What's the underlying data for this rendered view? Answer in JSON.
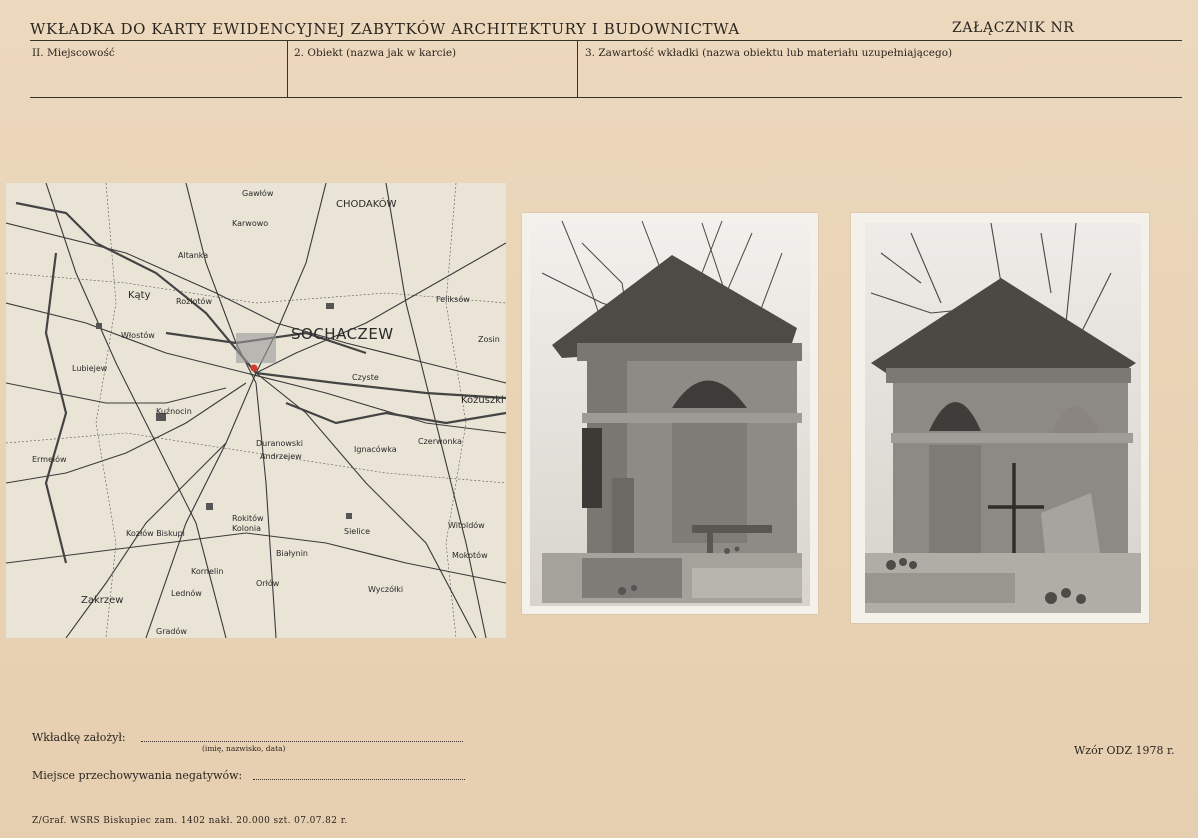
{
  "header": {
    "title": "WKŁADKA DO KARTY EWIDENCYJNEJ ZABYTKÓW ARCHITEKTURY I BUDOWNICTWA",
    "annex": "ZAŁĄCZNIK NR"
  },
  "fields": {
    "locality": "II. Miejscowość",
    "object": "2. Obiekt (nazwa jak w karcie)",
    "contents": "3. Zawartość wkładki (nazwa obiektu lub materiału uzupełniającego)"
  },
  "map": {
    "labels": {
      "sochaczew": "SOCHACZEW",
      "chodakow": "CHODAKÓW",
      "katy": "Kąty",
      "razlotow": "Rozlotów",
      "felikslow": "Feliksów",
      "gawlow": "Gawłów",
      "karwowo": "Karwowo",
      "altanka": "Altanka",
      "kozuszki": "Kożuszki",
      "czyste": "Czyste",
      "czerwonka": "Czerwonka",
      "duranow": "Duranowski",
      "andrzejew": "Andrzejew",
      "ignacow": "Ignacówka",
      "rokitow": "Rokitów",
      "kolonia": "Kolonia",
      "bialynin": "Białynin",
      "orlow": "Orłów",
      "zakrzew": "Zakrzew",
      "lednow": "Lednów",
      "kornelin": "Kornelin",
      "wyczolki": "Wyczółki",
      "sielice": "Sielice",
      "witoldow": "Witoldów",
      "mokotow": "Mokotów",
      "zosin": "Zosin",
      "lubiejew": "Lubiejew",
      "kuznocin": "Kuźnocin",
      "ermelow": "Ermelów",
      "kozlow": "Kozłów Biskupi",
      "gradow": "Gradów",
      "wlostow": "Włostów"
    }
  },
  "footer": {
    "founded_label": "Wkładkę założył:",
    "founded_hint": "(imię, nazwisko, data)",
    "storage_label": "Miejsce przechowywania negatywów:",
    "model": "Wzór ODZ 1978 r.",
    "print_info": "Z/Graf. WSRS Biskupiec zam. 1402 nakł. 20.000 szt. 07.07.82 r."
  },
  "colors": {
    "paper": "#e9d3b6",
    "ink": "#2b2520",
    "map_marker": "#d23a2a"
  }
}
